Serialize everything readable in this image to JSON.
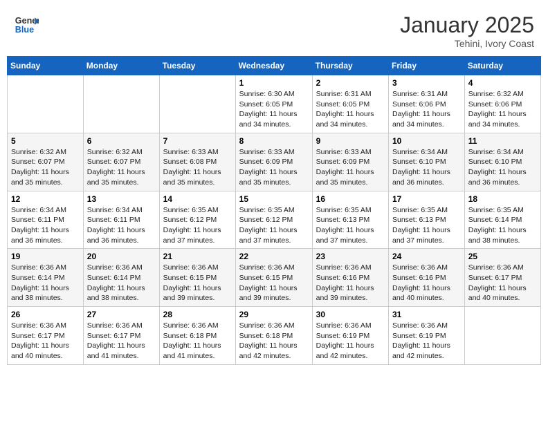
{
  "header": {
    "logo_text_general": "General",
    "logo_text_blue": "Blue",
    "month_title": "January 2025",
    "location": "Tehini, Ivory Coast"
  },
  "calendar": {
    "days_of_week": [
      "Sunday",
      "Monday",
      "Tuesday",
      "Wednesday",
      "Thursday",
      "Friday",
      "Saturday"
    ],
    "weeks": [
      [
        {
          "day": "",
          "info": ""
        },
        {
          "day": "",
          "info": ""
        },
        {
          "day": "",
          "info": ""
        },
        {
          "day": "1",
          "info": "Sunrise: 6:30 AM\nSunset: 6:05 PM\nDaylight: 11 hours and 34 minutes."
        },
        {
          "day": "2",
          "info": "Sunrise: 6:31 AM\nSunset: 6:05 PM\nDaylight: 11 hours and 34 minutes."
        },
        {
          "day": "3",
          "info": "Sunrise: 6:31 AM\nSunset: 6:06 PM\nDaylight: 11 hours and 34 minutes."
        },
        {
          "day": "4",
          "info": "Sunrise: 6:32 AM\nSunset: 6:06 PM\nDaylight: 11 hours and 34 minutes."
        }
      ],
      [
        {
          "day": "5",
          "info": "Sunrise: 6:32 AM\nSunset: 6:07 PM\nDaylight: 11 hours and 35 minutes."
        },
        {
          "day": "6",
          "info": "Sunrise: 6:32 AM\nSunset: 6:07 PM\nDaylight: 11 hours and 35 minutes."
        },
        {
          "day": "7",
          "info": "Sunrise: 6:33 AM\nSunset: 6:08 PM\nDaylight: 11 hours and 35 minutes."
        },
        {
          "day": "8",
          "info": "Sunrise: 6:33 AM\nSunset: 6:09 PM\nDaylight: 11 hours and 35 minutes."
        },
        {
          "day": "9",
          "info": "Sunrise: 6:33 AM\nSunset: 6:09 PM\nDaylight: 11 hours and 35 minutes."
        },
        {
          "day": "10",
          "info": "Sunrise: 6:34 AM\nSunset: 6:10 PM\nDaylight: 11 hours and 36 minutes."
        },
        {
          "day": "11",
          "info": "Sunrise: 6:34 AM\nSunset: 6:10 PM\nDaylight: 11 hours and 36 minutes."
        }
      ],
      [
        {
          "day": "12",
          "info": "Sunrise: 6:34 AM\nSunset: 6:11 PM\nDaylight: 11 hours and 36 minutes."
        },
        {
          "day": "13",
          "info": "Sunrise: 6:34 AM\nSunset: 6:11 PM\nDaylight: 11 hours and 36 minutes."
        },
        {
          "day": "14",
          "info": "Sunrise: 6:35 AM\nSunset: 6:12 PM\nDaylight: 11 hours and 37 minutes."
        },
        {
          "day": "15",
          "info": "Sunrise: 6:35 AM\nSunset: 6:12 PM\nDaylight: 11 hours and 37 minutes."
        },
        {
          "day": "16",
          "info": "Sunrise: 6:35 AM\nSunset: 6:13 PM\nDaylight: 11 hours and 37 minutes."
        },
        {
          "day": "17",
          "info": "Sunrise: 6:35 AM\nSunset: 6:13 PM\nDaylight: 11 hours and 37 minutes."
        },
        {
          "day": "18",
          "info": "Sunrise: 6:35 AM\nSunset: 6:14 PM\nDaylight: 11 hours and 38 minutes."
        }
      ],
      [
        {
          "day": "19",
          "info": "Sunrise: 6:36 AM\nSunset: 6:14 PM\nDaylight: 11 hours and 38 minutes."
        },
        {
          "day": "20",
          "info": "Sunrise: 6:36 AM\nSunset: 6:14 PM\nDaylight: 11 hours and 38 minutes."
        },
        {
          "day": "21",
          "info": "Sunrise: 6:36 AM\nSunset: 6:15 PM\nDaylight: 11 hours and 39 minutes."
        },
        {
          "day": "22",
          "info": "Sunrise: 6:36 AM\nSunset: 6:15 PM\nDaylight: 11 hours and 39 minutes."
        },
        {
          "day": "23",
          "info": "Sunrise: 6:36 AM\nSunset: 6:16 PM\nDaylight: 11 hours and 39 minutes."
        },
        {
          "day": "24",
          "info": "Sunrise: 6:36 AM\nSunset: 6:16 PM\nDaylight: 11 hours and 40 minutes."
        },
        {
          "day": "25",
          "info": "Sunrise: 6:36 AM\nSunset: 6:17 PM\nDaylight: 11 hours and 40 minutes."
        }
      ],
      [
        {
          "day": "26",
          "info": "Sunrise: 6:36 AM\nSunset: 6:17 PM\nDaylight: 11 hours and 40 minutes."
        },
        {
          "day": "27",
          "info": "Sunrise: 6:36 AM\nSunset: 6:17 PM\nDaylight: 11 hours and 41 minutes."
        },
        {
          "day": "28",
          "info": "Sunrise: 6:36 AM\nSunset: 6:18 PM\nDaylight: 11 hours and 41 minutes."
        },
        {
          "day": "29",
          "info": "Sunrise: 6:36 AM\nSunset: 6:18 PM\nDaylight: 11 hours and 42 minutes."
        },
        {
          "day": "30",
          "info": "Sunrise: 6:36 AM\nSunset: 6:19 PM\nDaylight: 11 hours and 42 minutes."
        },
        {
          "day": "31",
          "info": "Sunrise: 6:36 AM\nSunset: 6:19 PM\nDaylight: 11 hours and 42 minutes."
        },
        {
          "day": "",
          "info": ""
        }
      ]
    ]
  }
}
